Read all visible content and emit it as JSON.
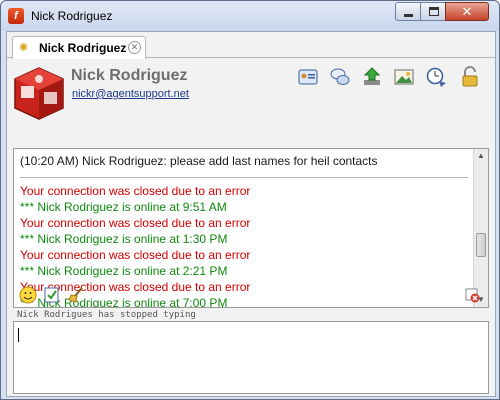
{
  "window": {
    "title": "Nick Rodriguez",
    "app_icon": "f"
  },
  "tab": {
    "label": "Nick Rodriguez",
    "icon": "sun-icon",
    "close_glyph": "⊗"
  },
  "contact": {
    "name": "Nick Rodriguez",
    "email": "nickr@agentsupport.net"
  },
  "toolbar_icons": [
    "contact-card-icon",
    "chat-bubbles-icon",
    "download-icon",
    "image-icon",
    "clock-icon",
    "lock-icon"
  ],
  "transcript": {
    "messages": [
      {
        "type": "normal",
        "text": "(10:20 AM) Nick Rodriguez: please add last names for heil contacts"
      },
      {
        "type": "err",
        "text": "Your connection was closed due to an error"
      },
      {
        "type": "ok",
        "text": "*** Nick Rodriguez is online at 9:51 AM"
      },
      {
        "type": "err",
        "text": "Your connection was closed due to an error"
      },
      {
        "type": "ok",
        "text": "*** Nick Rodriguez is online at 1:30 PM"
      },
      {
        "type": "err",
        "text": "Your connection was closed due to an error"
      },
      {
        "type": "ok",
        "text": "*** Nick Rodriguez is online at 2:21 PM"
      },
      {
        "type": "err",
        "text": "Your connection was closed due to an error"
      },
      {
        "type": "ok",
        "text": "*** Nick Rodriguez is online at 7:00 PM"
      }
    ]
  },
  "compose": {
    "typing_status": "Nick Rodrigues has stopped typing",
    "value": ""
  },
  "colors": {
    "error": "#d40000",
    "online": "#118a11",
    "link": "#1b3a8c"
  }
}
